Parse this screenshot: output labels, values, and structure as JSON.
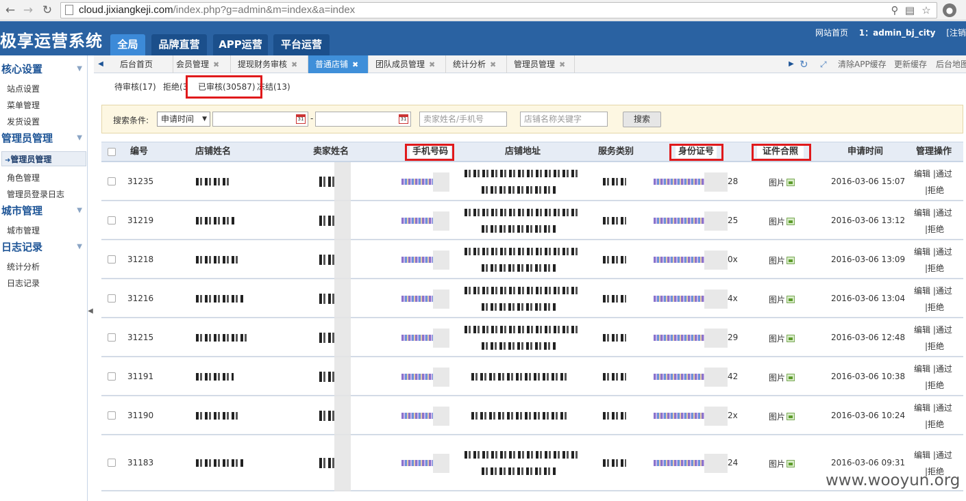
{
  "browser": {
    "url_host": "cloud.jixiangkeji.com",
    "url_path": "/index.php?g=admin&m=index&a=index"
  },
  "header": {
    "logo": "极享运营系统",
    "tabs": [
      {
        "label": "全局",
        "active": true
      },
      {
        "label": "品牌直营",
        "active": false
      },
      {
        "label": "APP运营",
        "active": false
      },
      {
        "label": "平台运营",
        "active": false
      }
    ],
    "links": {
      "home": "网站首页",
      "user": "1：admin_bj_city",
      "logout": "[注销"
    }
  },
  "sidebar": {
    "groups": [
      {
        "title": "核心设置",
        "items": [
          "站点设置",
          "菜单管理",
          "发货设置"
        ]
      },
      {
        "title": "管理员管理",
        "items": [
          "管理员管理",
          "角色管理",
          "管理员登录日志"
        ]
      },
      {
        "title": "城市管理",
        "items": [
          "城市管理"
        ]
      },
      {
        "title": "日志记录",
        "items": [
          "统计分析",
          "日志记录"
        ]
      }
    ],
    "active_item": "管理员管理"
  },
  "page_tabs": {
    "tabs": [
      {
        "label": "后台首页",
        "closable": false,
        "active": false
      },
      {
        "label": "会员管理",
        "closable": true,
        "active": false
      },
      {
        "label": "提现财务审核",
        "closable": true,
        "active": false
      },
      {
        "label": "普通店铺",
        "closable": true,
        "active": true
      },
      {
        "label": "团队成员管理",
        "closable": true,
        "active": false
      },
      {
        "label": "统计分析",
        "closable": true,
        "active": false
      },
      {
        "label": "管理员管理",
        "closable": true,
        "active": false
      }
    ],
    "right_actions": {
      "clear_app_cache": "清除APP缓存",
      "update_cache": "更新缓存",
      "site_map": "后台地图"
    }
  },
  "filters": {
    "pending": "待审核(17)",
    "rejected": "拒绝(3",
    "approved": "已审核(30587)",
    "frozen": "冻结(13)"
  },
  "search": {
    "label": "搜索条件:",
    "field_select": "申请时间",
    "date_separator": "-",
    "seller_placeholder": "卖家姓名/手机号",
    "shop_placeholder": "店铺名称关键字",
    "button": "搜索"
  },
  "table": {
    "columns": [
      "编号",
      "店铺姓名",
      "卖家姓名",
      "手机号码",
      "店铺地址",
      "服务类别",
      "身份证号",
      "证件合照",
      "申请时间",
      "管理操作"
    ],
    "rows": [
      {
        "id": "31235",
        "id_suffix": "28",
        "photo": "图片",
        "time": "2016-03-06 15:07"
      },
      {
        "id": "31219",
        "id_suffix": "25",
        "photo": "图片",
        "time": "2016-03-06 13:12"
      },
      {
        "id": "31218",
        "id_suffix": "0x",
        "photo": "图片",
        "time": "2016-03-06 13:09"
      },
      {
        "id": "31216",
        "id_suffix": "4x",
        "photo": "图片",
        "time": "2016-03-06 13:04"
      },
      {
        "id": "31215",
        "id_suffix": "29",
        "photo": "图片",
        "time": "2016-03-06 12:48"
      },
      {
        "id": "31191",
        "id_suffix": "42",
        "photo": "图片",
        "time": "2016-03-06 10:38"
      },
      {
        "id": "31190",
        "id_suffix": "2x",
        "photo": "图片",
        "time": "2016-03-06 10:24"
      },
      {
        "id": "31183",
        "id_suffix": "24",
        "photo": "图片",
        "time": "2016-03-06 09:31"
      }
    ],
    "ops": {
      "edit": "编辑",
      "sep": "|",
      "approve": "通过",
      "reject": "拒绝"
    }
  },
  "watermark": "www.wooyun.org"
}
